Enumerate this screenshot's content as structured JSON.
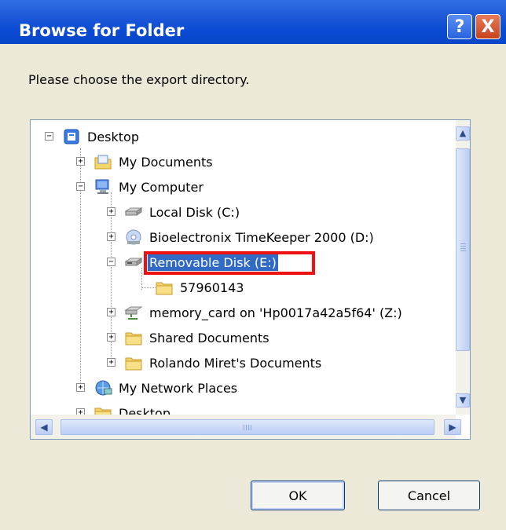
{
  "window": {
    "title": "Browse for Folder",
    "help_label": "?",
    "close_label": "X"
  },
  "prompt": "Please choose the export directory.",
  "tree": {
    "items": [
      {
        "label": "Desktop",
        "icon": "desktop-icon",
        "level": 0,
        "expander": "-"
      },
      {
        "label": "My Documents",
        "icon": "my-documents-icon",
        "level": 1,
        "expander": "+"
      },
      {
        "label": "My Computer",
        "icon": "my-computer-icon",
        "level": 1,
        "expander": "-"
      },
      {
        "label": "Local Disk (C:)",
        "icon": "hard-disk-icon",
        "level": 2,
        "expander": "+"
      },
      {
        "label": "Bioelectronix TimeKeeper 2000 (D:)",
        "icon": "cd-drive-icon",
        "level": 2,
        "expander": "+"
      },
      {
        "label": "Removable Disk (E:)",
        "icon": "removable-disk-icon",
        "level": 2,
        "expander": "-",
        "selected": true
      },
      {
        "label": "57960143",
        "icon": "folder-icon",
        "level": 3,
        "expander": ""
      },
      {
        "label": "memory_card on 'Hp0017a42a5f64' (Z:)",
        "icon": "network-drive-icon",
        "level": 2,
        "expander": "+"
      },
      {
        "label": "Shared Documents",
        "icon": "folder-icon",
        "level": 2,
        "expander": "+"
      },
      {
        "label": "Rolando Miret's Documents",
        "icon": "folder-icon",
        "level": 2,
        "expander": "+"
      },
      {
        "label": "My Network Places",
        "icon": "network-places-icon",
        "level": 1,
        "expander": "+"
      },
      {
        "label": "Desktop",
        "icon": "folder-icon",
        "level": 1,
        "expander": "+"
      }
    ]
  },
  "buttons": {
    "ok_label": "OK",
    "cancel_label": "Cancel"
  },
  "colors": {
    "titlebar": "#0a4ad3",
    "selection": "#316ac5",
    "highlight_outline": "#e11111",
    "dialog_bg": "#ece9d8"
  }
}
